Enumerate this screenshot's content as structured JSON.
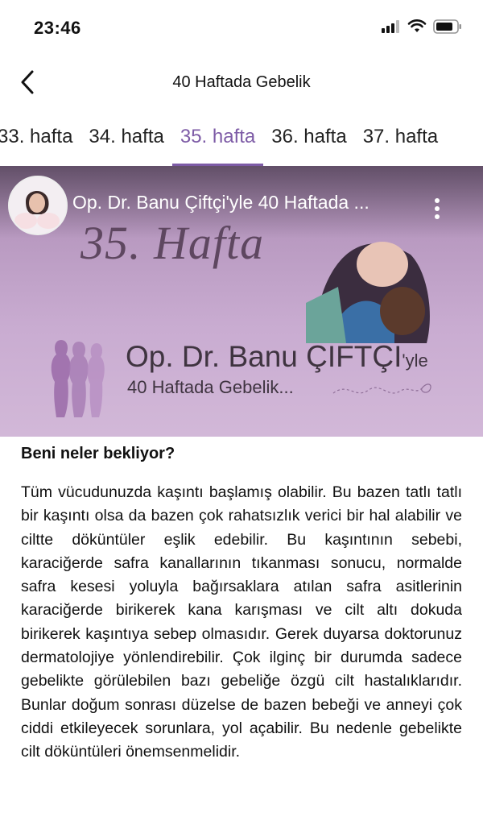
{
  "status_bar": {
    "time": "23:46",
    "icons": [
      "signal-icon",
      "wifi-icon",
      "battery-icon"
    ]
  },
  "header": {
    "title": "40 Haftada Gebelik",
    "back_icon": "chevron-left-icon"
  },
  "week_tabs": {
    "items": [
      "33. hafta",
      "34. hafta",
      "35. hafta",
      "36. hafta",
      "37. hafta"
    ],
    "active": "35. hafta"
  },
  "video": {
    "title": "Op. Dr. Banu Çiftçi'yle 40 Haftada ...",
    "thumbnail_script": "35. Hafta",
    "thumbnail_brand_name": "Op. Dr. Banu ÇİFTÇİ",
    "thumbnail_brand_suffix": "'yle",
    "thumbnail_subtitle": "40 Haftada Gebelik...",
    "play_icon": "play-button-icon",
    "menu_icon": "more-vertical-icon",
    "colors": {
      "play": "#ff0000",
      "thumb_bg": "#c9acd1"
    }
  },
  "content": {
    "heading": "Beni neler bekliyor?",
    "paragraph": "Tüm vücudunuzda kaşıntı başlamış olabilir. Bu bazen tatlı tatlı bir kaşıntı olsa da bazen çok rahatsızlık verici bir hal alabilir ve ciltte döküntüler eşlik edebilir. Bu kaşıntının sebebi, karaciğerde safra kanallarının tıkanması sonucu, normalde safra kesesi yoluyla bağırsaklara atılan safra asitlerinin karaciğerde birikerek kana karışması ve cilt altı dokuda birikerek kaşıntıya sebep olmasıdır. Gerek duyarsa doktorunuz dermatolojiye yönlendirebilir. Çok ilginç bir durumda sadece gebelikte görülebilen bazı gebeliğe özgü cilt hastalıklarıdır. Bunlar doğum sonrası düzelse de bazen bebeği ve anneyi çok ciddi etkileyecek sorunlara, yol açabilir. Bu nedenle gebelikte cilt döküntüleri önemsenmelidir."
  },
  "colors": {
    "accent": "#7d5ba6"
  }
}
